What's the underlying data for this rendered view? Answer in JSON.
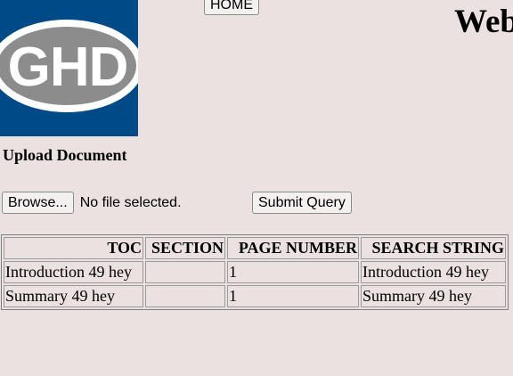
{
  "logo": {
    "text": "GHD",
    "icon": "ghd-logo",
    "colors": {
      "background": "#004a87",
      "ring": "#ffffff",
      "oval": "#8c8c8c",
      "letters": "#ffffff"
    }
  },
  "nav": {
    "home_label": "HOME"
  },
  "header": {
    "title": "Web"
  },
  "upload": {
    "heading": "Upload Document",
    "browse_label": "Browse...",
    "file_status": "No file selected.",
    "submit_label": "Submit Query"
  },
  "table": {
    "headers": [
      "TOC",
      "SECTION",
      "PAGE NUMBER",
      "SEARCH STRING"
    ],
    "rows": [
      [
        "Introduction 49 hey",
        "",
        "1",
        "Introduction 49 hey"
      ],
      [
        "Summary 49 hey",
        "",
        "1",
        "Summary 49 hey"
      ]
    ]
  }
}
